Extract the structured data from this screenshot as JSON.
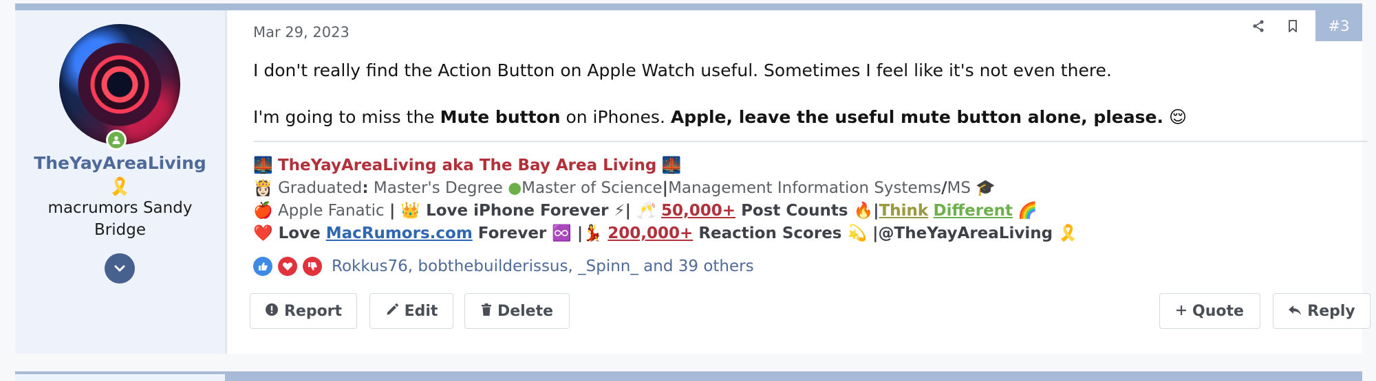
{
  "user": {
    "username": "TheYayAreaLiving",
    "ribbon_emoji": "🎗️",
    "title": "macrumors Sandy Bridge"
  },
  "post": {
    "date": "Mar 29, 2023",
    "number": "#3",
    "paragraph1": "I don't really find the Action Button on Apple Watch useful. Sometimes I feel like it's not even there.",
    "paragraph2_part1": "I'm going to miss the ",
    "paragraph2_bold1": "Mute button",
    "paragraph2_part2": " on iPhones. ",
    "paragraph2_bold2": "Apple, leave the useful mute button alone, please.",
    "paragraph2_emoji": "😌"
  },
  "signature": {
    "line1_emoji": "🌉",
    "line1_text": "TheYayAreaLiving aka The Bay Area Living",
    "line2_emoji": "👸🏻",
    "line2_a": "Graduated",
    "line2_colon": ":",
    "line2_b": " Master's Degree ",
    "line2_dot": "●",
    "line2_c": "Master of Science",
    "line2_pipe": "|",
    "line2_d": "Management Information Systems",
    "line2_slash": "/",
    "line2_e": "MS ",
    "line2_cap": "🎓",
    "line3_apple": "🍎",
    "line3_a": " Apple Fanatic ",
    "line3_pipe1": "| ",
    "line3_crown": "👑",
    "line3_b": " Love iPhone Forever ",
    "line3_bolt": "⚡",
    "line3_pipe2": "| ",
    "line3_cheers": "🥂",
    "line3_count": "50,000+",
    "line3_c": " Post Counts ",
    "line3_fire": "🔥",
    "line3_pipe3": "|",
    "line3_think": "Think",
    "line3_different": "Different",
    "line3_rainbow": "🌈",
    "line4_heart": "❤️",
    "line4_a": " Love ",
    "line4_link": "MacRumors.com",
    "line4_b": " Forever ♾️ |",
    "line4_dancer": "💃",
    "line4_count": "200,000+",
    "line4_c": " Reaction Scores ",
    "line4_dizzy": "💫",
    "line4_d": " |@TheYayAreaLiving ",
    "line4_ribbon": "🎗️"
  },
  "reactions": {
    "text": "Rokkus76, bobthebuilderissus, _Spinn_ and 39 others",
    "colors": {
      "like": "#3d8be6",
      "love": "#e0333b",
      "dislike": "#e0333b"
    }
  },
  "actions": {
    "report": "Report",
    "edit": "Edit",
    "delete": "Delete",
    "quote": "Quote",
    "reply": "Reply"
  }
}
